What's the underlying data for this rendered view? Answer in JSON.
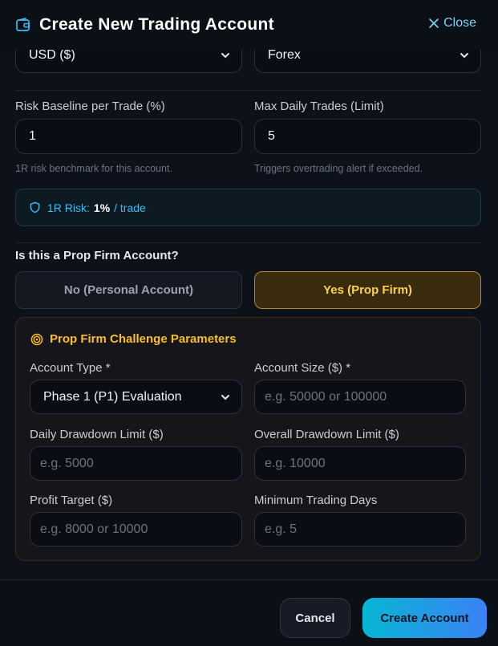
{
  "header": {
    "title": "Create New Trading Account",
    "close_label": "Close"
  },
  "top_fields": {
    "currency": {
      "value": "USD ($)"
    },
    "market": {
      "value": "Forex"
    }
  },
  "risk": {
    "label": "Risk Baseline per Trade (%)",
    "value": "1",
    "hint": "1R risk benchmark for this account."
  },
  "max_trades": {
    "label": "Max Daily Trades (Limit)",
    "value": "5",
    "hint": "Triggers overtrading alert if exceeded."
  },
  "risk_summary": {
    "label": "1R Risk:",
    "value": "1%",
    "unit": "/ trade"
  },
  "prop_question": "Is this a Prop Firm Account?",
  "prop_toggle": {
    "no_label": "No (Personal Account)",
    "yes_label": "Yes (Prop Firm)",
    "selected": "yes"
  },
  "prop_panel": {
    "title": "Prop Firm Challenge Parameters",
    "account_type": {
      "label": "Account Type *",
      "value": "Phase 1 (P1) Evaluation"
    },
    "account_size": {
      "label": "Account Size ($) *",
      "placeholder": "e.g. 50000 or 100000"
    },
    "daily_drawdown": {
      "label": "Daily Drawdown Limit ($)",
      "placeholder": "e.g. 5000"
    },
    "overall_drawdown": {
      "label": "Overall Drawdown Limit ($)",
      "placeholder": "e.g. 10000"
    },
    "profit_target": {
      "label": "Profit Target ($)",
      "placeholder": "e.g. 8000 or 10000"
    },
    "min_days": {
      "label": "Minimum Trading Days",
      "placeholder": "e.g. 5"
    }
  },
  "footer": {
    "cancel_label": "Cancel",
    "create_label": "Create Account"
  },
  "colors": {
    "accent_cyan": "#38bdf8",
    "prop_gold": "#fbbf24",
    "background": "#0d1119"
  },
  "icons": {
    "header": "wallet-icon",
    "close": "close-icon",
    "risk": "shield-icon",
    "prop": "target-icon",
    "select": "chevron-down-icon"
  }
}
